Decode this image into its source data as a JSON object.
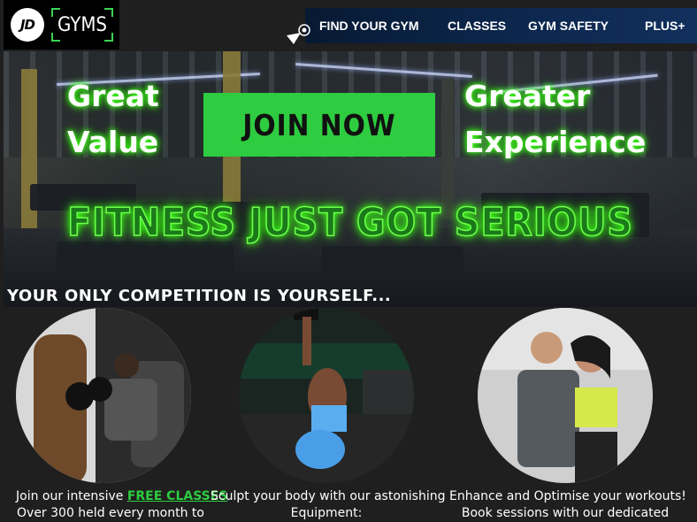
{
  "header": {
    "logo": {
      "mark": "JD",
      "name": "GYMS"
    },
    "nav": [
      "FIND YOUR GYM",
      "CLASSES",
      "GYM SAFETY",
      "PLUS+"
    ]
  },
  "hero": {
    "left_line1": "Great",
    "left_line2": "Value",
    "cta": "JOIN NOW",
    "right_line1": "Greater",
    "right_line2": "Experience",
    "tagline": "FITNESS JUST GOT SERIOUS",
    "subtitle": "YOUR ONLY COMPETITION IS YOURSELF..."
  },
  "cards": [
    {
      "line1_pre": "Join our intensive ",
      "line1_link": "FREE CLASSES",
      "line2": "Over 300 held every month to"
    },
    {
      "line1": "Sculpt your body with our astonishing",
      "line2": "Equipment:"
    },
    {
      "line1": "Enhance and Optimise your workouts!",
      "line2": "Book sessions with our dedicated"
    }
  ],
  "colors": {
    "accent": "#2ecc40",
    "nav_bg": "#0d2850",
    "page_bg": "#1f1f1f"
  }
}
